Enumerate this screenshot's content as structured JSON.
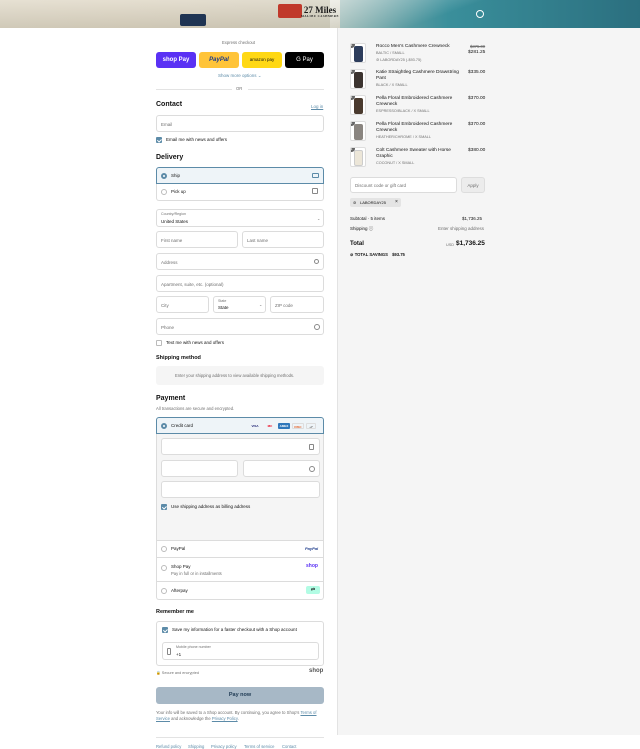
{
  "brand": {
    "name": "27 Miles",
    "tagline": "MALIBU CASHMERE"
  },
  "express": {
    "label": "Express checkout",
    "buttons": [
      "shop Pay",
      "PayPal",
      "amazon pay",
      "G Pay"
    ],
    "more": "Show more options",
    "or": "OR"
  },
  "contact": {
    "title": "Contact",
    "login": "Log in",
    "email_placeholder": "Email",
    "email_news": "Email me with news and offers"
  },
  "delivery": {
    "title": "Delivery",
    "options": [
      "Ship",
      "Pick up"
    ],
    "country_label": "Country/Region",
    "country_value": "United States",
    "first_name": "First name",
    "last_name": "Last name",
    "address": "Address",
    "apartment": "Apartment, suite, etc. (optional)",
    "city": "City",
    "state_label": "State",
    "state_value": "State",
    "zip": "ZIP code",
    "phone": "Phone",
    "text_news": "Text me with news and offers"
  },
  "shipping_method": {
    "title": "Shipping method",
    "note": "Enter your shipping address to view available shipping methods."
  },
  "payment": {
    "title": "Payment",
    "subtitle": "All transactions are secure and encrypted.",
    "credit_card": "Credit card",
    "card_brands": [
      "VISA",
      "MC",
      "AMEX",
      "DISC"
    ],
    "more_brands": "+7",
    "billing_same": "Use shipping address as billing address",
    "paypal": "PayPal",
    "paypal_logo": "PayPal",
    "shop_pay": "Shop Pay",
    "shop_pay_sub": "Pay in full or in installments",
    "shop_logo": "shop",
    "afterpay": "Afterpay"
  },
  "remember": {
    "title": "Remember me",
    "save_label": "Save my information for a faster checkout with a Shop account",
    "phone_label": "Mobile phone number",
    "phone_value": "+1",
    "secure": "Secure and encrypted",
    "shop_logo": "shop"
  },
  "pay_button": "Pay now",
  "legal": {
    "line1": "Your info will be saved to a Shop account. By continuing, you agree to Shop's",
    "tos": "Terms of Service",
    "and": " and acknowledge the ",
    "privacy": "Privacy Policy",
    "end": "."
  },
  "footer_links": [
    "Refund policy",
    "Shipping",
    "Privacy policy",
    "Terms of service",
    "Contact"
  ],
  "cart": {
    "items": [
      {
        "qty": "1",
        "name": "Rocco Men's Cashmere Crewneck",
        "variant": "BALTIC / SMALL",
        "discount": "LABORDAY25 (-$93.75)",
        "old_price": "$375.00",
        "price": "$281.25",
        "color": "#2d3d5c"
      },
      {
        "qty": "1",
        "name": "Katie Straightleg Cashmere Drawstring Pant",
        "variant": "BLACK / X SMALL",
        "price": "$335.00",
        "color": "#3c3430"
      },
      {
        "qty": "1",
        "name": "Pella Floral Embroidered Cashmere Crewneck",
        "variant": "ESPRESSO/BLACK / X SMALL",
        "price": "$370.00",
        "color": "#4a3a2e"
      },
      {
        "qty": "1",
        "name": "Pella Floral Embroidered Cashmere Crewneck",
        "variant": "HEATHER/CHROME / X SMALL",
        "price": "$370.00",
        "color": "#8a8580"
      },
      {
        "qty": "1",
        "name": "Colt Cashmere Sweater with Horse Graphic",
        "variant": "COCONUT / X SMALL",
        "price": "$380.00",
        "color": "#ece6d8"
      }
    ],
    "discount_placeholder": "Discount code or gift card",
    "apply": "Apply",
    "applied_code": "LABORDAY25",
    "subtotal_label": "Subtotal · 5 items",
    "subtotal_value": "$1,736.25",
    "shipping_label": "Shipping",
    "shipping_value": "Enter shipping address",
    "total_label": "Total",
    "currency": "USD",
    "total_value": "$1,736.25",
    "savings_label": "TOTAL SAVINGS",
    "savings_value": "$93.75"
  }
}
